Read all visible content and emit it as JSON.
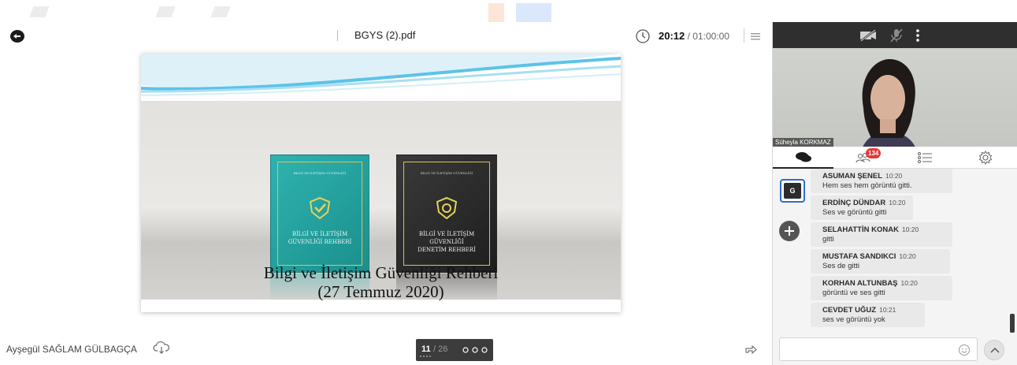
{
  "header": {
    "document_title": "BGYS (2).pdf",
    "elapsed_time": "20:12",
    "total_time": "/ 01:00:00"
  },
  "slide": {
    "title_line1": "Bilgi ve İletişim Güvenliği Rehberi",
    "title_line2": "(27 Temmuz 2020)",
    "book1": {
      "header": "BİLGİ VE İLETİŞİM GÜVENLİĞİ",
      "line1": "BİLGİ VE İLETİŞİM",
      "line2": "GÜVENLİĞİ REHBERİ",
      "color": "#2fb3b0"
    },
    "book2": {
      "header": "BİLGİ VE İLETİŞİM GÜVENLİĞİ",
      "line1": "BİLGİ VE İLETİŞİM",
      "line2": "GÜVENLİĞİ",
      "line3": "DENETİM REHBERİ",
      "color": "#2b2b2b"
    }
  },
  "footer": {
    "presenter_name": "Ayşegül SAĞLAM GÜLBAGÇA",
    "current_page": "11",
    "total_pages": "/ 26"
  },
  "video": {
    "participant_name": "Süheyla KORKMAZ"
  },
  "tabs": {
    "participants_badge": "134"
  },
  "side": {
    "group_label": "G"
  },
  "chat": {
    "messages": [
      {
        "author": "ASUMAN ŞENEL",
        "time": "10:20",
        "text": "Hem ses hem görüntü gitti."
      },
      {
        "author": "ERDİNÇ DÜNDAR",
        "time": "10:20",
        "text": "Ses ve görüntü gitti"
      },
      {
        "author": "SELAHATTİN KONAK",
        "time": "10:20",
        "text": "gitti"
      },
      {
        "author": "MUSTAFA SANDIKCI",
        "time": "10:20",
        "text": "Ses de gitti"
      },
      {
        "author": "KORHAN ALTUNBAŞ",
        "time": "10:20",
        "text": "görüntü ve ses gitti"
      },
      {
        "author": "CEVDET UĞUZ",
        "time": "10:21",
        "text": "ses ve görüntü yok"
      }
    ],
    "input_placeholder": ""
  },
  "colors": {
    "accent_blue": "#2f6fc8",
    "badge_red": "#e53935",
    "panel_dark": "#2f2f2f"
  }
}
